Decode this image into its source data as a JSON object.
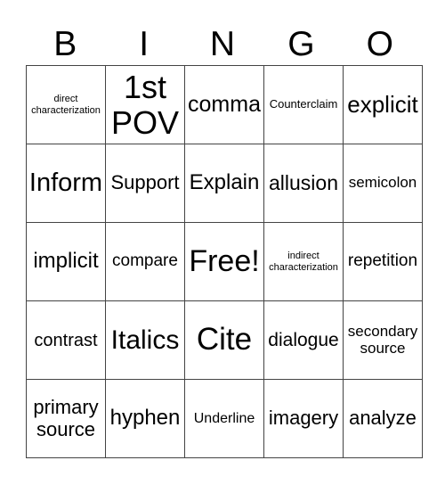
{
  "header": [
    "B",
    "I",
    "N",
    "G",
    "O"
  ],
  "rows": [
    [
      {
        "text": "direct characterization",
        "size": 11
      },
      {
        "text": "1st POV",
        "size": 36
      },
      {
        "text": "comma",
        "size": 25
      },
      {
        "text": "Counterclaim",
        "size": 13
      },
      {
        "text": "explicit",
        "size": 26
      }
    ],
    [
      {
        "text": "Inform",
        "size": 29
      },
      {
        "text": "Support",
        "size": 22
      },
      {
        "text": "Explain",
        "size": 24
      },
      {
        "text": "allusion",
        "size": 23
      },
      {
        "text": "semicolon",
        "size": 17
      }
    ],
    [
      {
        "text": "implicit",
        "size": 24
      },
      {
        "text": "compare",
        "size": 19
      },
      {
        "text": "Free!",
        "size": 34
      },
      {
        "text": "indirect characterization",
        "size": 11
      },
      {
        "text": "repetition",
        "size": 19
      }
    ],
    [
      {
        "text": "contrast",
        "size": 20
      },
      {
        "text": "Italics",
        "size": 30
      },
      {
        "text": "Cite",
        "size": 35
      },
      {
        "text": "dialogue",
        "size": 21
      },
      {
        "text": "secondary source",
        "size": 17
      }
    ],
    [
      {
        "text": "primary source",
        "size": 22
      },
      {
        "text": "hyphen",
        "size": 24
      },
      {
        "text": "Underline",
        "size": 16
      },
      {
        "text": "imagery",
        "size": 22
      },
      {
        "text": "analyze",
        "size": 22
      }
    ]
  ]
}
